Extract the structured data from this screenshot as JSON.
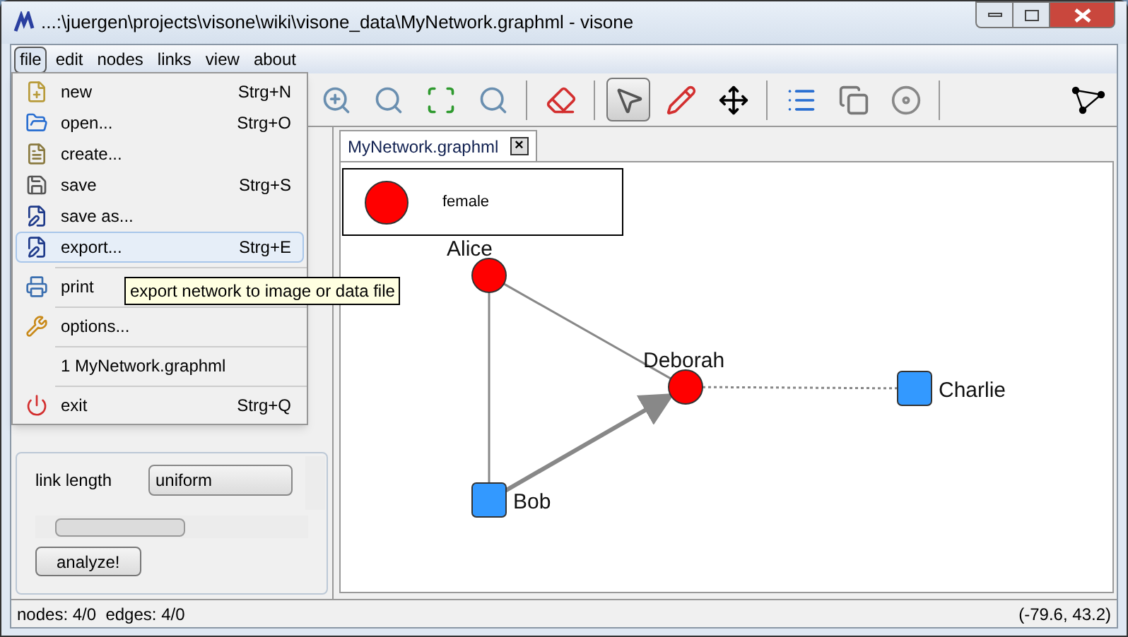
{
  "window": {
    "title": "...:\\juergen\\projects\\visone\\wiki\\visone_data\\MyNetwork.graphml - visone"
  },
  "menubar": [
    {
      "label": "file",
      "selected": true
    },
    {
      "label": "edit",
      "selected": false
    },
    {
      "label": "nodes",
      "selected": false
    },
    {
      "label": "links",
      "selected": false
    },
    {
      "label": "view",
      "selected": false
    },
    {
      "label": "about",
      "selected": false
    }
  ],
  "file_menu": [
    {
      "kind": "item",
      "label": "new",
      "shortcut": "Strg+N",
      "selected": false
    },
    {
      "kind": "item",
      "label": "open...",
      "shortcut": "Strg+O",
      "selected": false
    },
    {
      "kind": "item",
      "label": "create...",
      "selected": false
    },
    {
      "kind": "item",
      "label": "save",
      "shortcut": "Strg+S",
      "selected": false
    },
    {
      "kind": "item",
      "label": "save as...",
      "selected": false
    },
    {
      "kind": "item",
      "label": "export...",
      "shortcut": "Strg+E",
      "selected": true
    },
    {
      "kind": "separator"
    },
    {
      "kind": "item",
      "label": "print",
      "selected": false
    },
    {
      "kind": "separator"
    },
    {
      "kind": "item",
      "label": "options...",
      "selected": false
    },
    {
      "kind": "separator"
    },
    {
      "kind": "item",
      "label": "1 MyNetwork.graphml",
      "selected": false
    },
    {
      "kind": "separator"
    },
    {
      "kind": "item",
      "label": "exit",
      "shortcut": "Strg+Q",
      "selected": false
    }
  ],
  "tooltip": "export network to image or data file",
  "toolbar": [
    {
      "kind": "zoom-in",
      "selected": false
    },
    {
      "kind": "zoom-actual",
      "selected": false
    },
    {
      "kind": "zoom-fit",
      "selected": false
    },
    {
      "kind": "zoom-selection",
      "selected": false
    },
    {
      "kind": "separator"
    },
    {
      "kind": "transform",
      "selected": false
    },
    {
      "kind": "separator"
    },
    {
      "kind": "select",
      "selected": true
    },
    {
      "kind": "draw",
      "selected": false
    },
    {
      "kind": "move",
      "selected": false
    },
    {
      "kind": "separator"
    },
    {
      "kind": "list",
      "selected": false
    },
    {
      "kind": "copy",
      "selected": false
    },
    {
      "kind": "disc",
      "selected": false
    },
    {
      "kind": "separator"
    }
  ],
  "left_panel": {
    "link_length": {
      "label": "link length",
      "value": "uniform"
    },
    "button": "analyze!"
  },
  "tab": {
    "label": "MyNetwork.graphml",
    "close": "×"
  },
  "legend": [
    {
      "kind": "circle",
      "color": "#ff0000",
      "label": "female"
    }
  ],
  "graph": {
    "nodes": [
      {
        "name": "Alice",
        "kind": "circle",
        "color": "#ff0000"
      },
      {
        "name": "Deborah",
        "kind": "circle",
        "color": "#ff0000"
      },
      {
        "name": "Charlie",
        "kind": "square",
        "color": "#3399ff"
      },
      {
        "name": "Bob",
        "kind": "square",
        "color": "#3399ff"
      }
    ]
  },
  "status_bar": {
    "counts": "nodes: 4/0  edges: 4/0",
    "coordinates": "(-79.6, 43.2)"
  }
}
